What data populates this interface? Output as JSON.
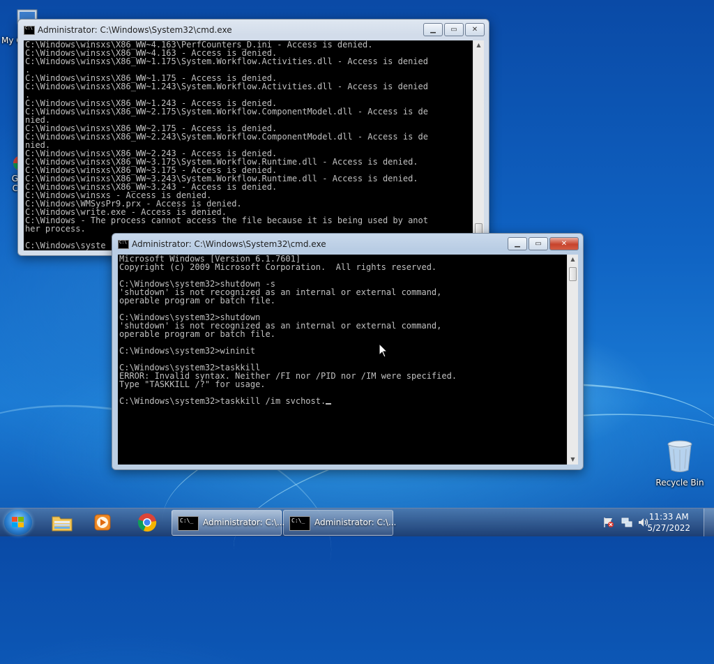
{
  "desktop": {
    "icons": [
      {
        "label": "My C",
        "name": "computer"
      },
      {
        "label": "G",
        "label2": "C",
        "name": "chrome"
      },
      {
        "label": "Recycle Bin",
        "name": "recycle-bin"
      }
    ]
  },
  "window_back": {
    "title": "Administrator: C:\\Windows\\System32\\cmd.exe",
    "lines": [
      "C:\\Windows\\winsxs\\X86_WW~4.163\\PerfCounters_D.ini - Access is denied.",
      "C:\\Windows\\winsxs\\X86_WW~4.163 - Access is denied.",
      "C:\\Windows\\winsxs\\X86_WW~1.175\\System.Workflow.Activities.dll - Access is denied",
      ".",
      "C:\\Windows\\winsxs\\X86_WW~1.175 - Access is denied.",
      "C:\\Windows\\winsxs\\X86_WW~1.243\\System.Workflow.Activities.dll - Access is denied",
      ".",
      "C:\\Windows\\winsxs\\X86_WW~1.243 - Access is denied.",
      "C:\\Windows\\winsxs\\X86_WW~2.175\\System.Workflow.ComponentModel.dll - Access is de",
      "nied.",
      "C:\\Windows\\winsxs\\X86_WW~2.175 - Access is denied.",
      "C:\\Windows\\winsxs\\X86_WW~2.243\\System.Workflow.ComponentModel.dll - Access is de",
      "nied.",
      "C:\\Windows\\winsxs\\X86_WW~2.243 - Access is denied.",
      "C:\\Windows\\winsxs\\X86_WW~3.175\\System.Workflow.Runtime.dll - Access is denied.",
      "C:\\Windows\\winsxs\\X86_WW~3.175 - Access is denied.",
      "C:\\Windows\\winsxs\\X86_WW~3.243\\System.Workflow.Runtime.dll - Access is denied.",
      "C:\\Windows\\winsxs\\X86_WW~3.243 - Access is denied.",
      "C:\\Windows\\winsxs - Access is denied.",
      "C:\\Windows\\WMSysPr9.prx - Access is denied.",
      "C:\\Windows\\write.exe - Access is denied.",
      "C:\\Windows - The process cannot access the file because it is being used by anot",
      "her process.",
      "",
      "C:\\Windows\\syste"
    ]
  },
  "window_front": {
    "title": "Administrator: C:\\Windows\\System32\\cmd.exe",
    "lines": [
      "Microsoft Windows [Version 6.1.7601]",
      "Copyright (c) 2009 Microsoft Corporation.  All rights reserved.",
      "",
      "C:\\Windows\\system32>shutdown -s",
      "'shutdown' is not recognized as an internal or external command,",
      "operable program or batch file.",
      "",
      "C:\\Windows\\system32>shutdown",
      "'shutdown' is not recognized as an internal or external command,",
      "operable program or batch file.",
      "",
      "C:\\Windows\\system32>wininit",
      "",
      "C:\\Windows\\system32>taskkill",
      "ERROR: Invalid syntax. Neither /FI nor /PID nor /IM were specified.",
      "Type \"TASKKILL /?\" for usage.",
      ""
    ],
    "input_line": "C:\\Windows\\system32>taskkill /im svchost."
  },
  "taskbar": {
    "tasks": [
      {
        "label": "Administrator: C:\\..."
      },
      {
        "label": "Administrator: C:\\..."
      }
    ],
    "pinned": [
      "explorer",
      "media-player",
      "chrome"
    ],
    "clock": {
      "time": "11:33 AM",
      "date": "5/27/2022"
    }
  }
}
